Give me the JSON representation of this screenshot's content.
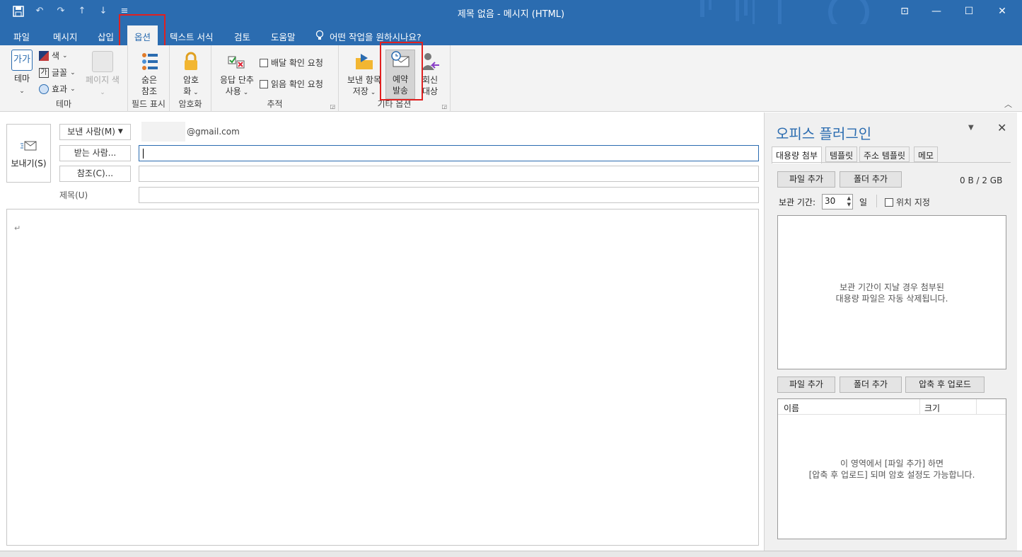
{
  "window": {
    "title": "제목 없음  -  메시지 (HTML)",
    "accent_color": "#2b6cb0",
    "highlight_color": "#e02020"
  },
  "qat": {
    "save_icon": "save-icon",
    "undo_icon": "undo-icon",
    "redo_icon": "redo-icon",
    "up_icon": "arrow-up-icon",
    "down_icon": "arrow-down-icon",
    "customize_icon": "customize-icon"
  },
  "tabs": [
    {
      "label": "파일"
    },
    {
      "label": "메시지"
    },
    {
      "label": "삽입"
    },
    {
      "label": "옵션"
    },
    {
      "label": "텍스트 서식"
    },
    {
      "label": "검토"
    },
    {
      "label": "도움말"
    }
  ],
  "tell_me": "어떤 작업을 원하시나요?",
  "ribbon": {
    "theme": {
      "group": "테마",
      "theme_btn": "테마",
      "theme_icon_text": "가가",
      "colors": "색",
      "fonts": "글꼴",
      "fonts_icon_text": "가",
      "effects": "효과",
      "page_color": "페이지 색"
    },
    "fields": {
      "group": "필드 표시",
      "bcc_line1": "숨은",
      "bcc_line2": "참조"
    },
    "encrypt": {
      "group": "암호화",
      "btn_line1": "암호",
      "btn_line2": "화"
    },
    "tracking": {
      "group": "추적",
      "voting_line1": "응답 단추",
      "voting_line2": "사용",
      "delivery_receipt": "배달 확인 요청",
      "read_receipt": "읽음 확인 요청"
    },
    "more_options": {
      "group": "기타 옵션",
      "save_sent_line1": "보낸 항목",
      "save_sent_line2": "저장",
      "delay_line1": "예약",
      "delay_line2": "발송",
      "reply_line1": "회신",
      "reply_line2": "대상"
    }
  },
  "compose": {
    "send": "보내기(S)",
    "from_label": "보낸 사람(M)",
    "from_value": "@gmail.com",
    "to_label": "받는 사람...",
    "cc_label": "참조(C)...",
    "subject_label": "제목(U)",
    "to_value": "",
    "cc_value": "",
    "subject_value": "",
    "body_mark": "↵"
  },
  "plugin": {
    "title": "오피스 플러그인",
    "tabs": [
      "대용량 첨부",
      "템플릿",
      "주소 템플릿",
      "메모"
    ],
    "add_file": "파일 추가",
    "add_folder": "폴더 추가",
    "quota": "0 B / 2 GB",
    "retention_label": "보관 기간:",
    "retention_value": "30",
    "retention_unit": "일",
    "set_location": "위치 지정",
    "dropzone_line1": "보관 기간이 지날 경우 첨부된",
    "dropzone_line2": "대용량 파일은 자동 삭제됩니다.",
    "add_file2": "파일 추가",
    "add_folder2": "폴더 추가",
    "zip_upload": "압축 후  업로드",
    "col_name": "이름",
    "col_size": "크기",
    "list_hint_line1": "이 영역에서 [파일 추가] 하면",
    "list_hint_line2": "[압축 후 업로드] 되며 암호 설정도 가능합니다."
  }
}
